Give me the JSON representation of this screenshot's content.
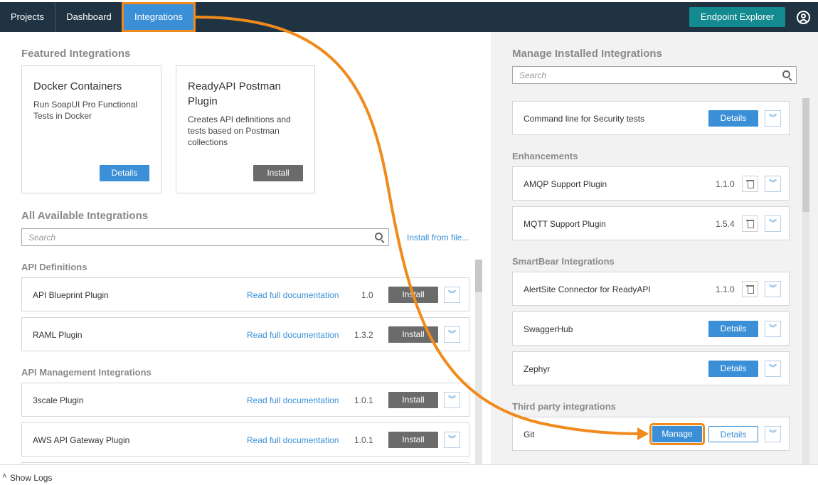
{
  "nav": {
    "tabs": [
      "Projects",
      "Dashboard",
      "Integrations"
    ],
    "endpoint_explorer": "Endpoint Explorer"
  },
  "featured": {
    "title": "Featured Integrations",
    "cards": [
      {
        "title": "Docker Containers",
        "desc": "Run SoapUI Pro Functional Tests in Docker",
        "button": "Details"
      },
      {
        "title": "ReadyAPI Postman Plugin",
        "desc": "Creates API definitions and tests based on Postman collections",
        "button": "Install"
      }
    ]
  },
  "available": {
    "title": "All Available Integrations",
    "search_placeholder": "Search",
    "install_from_file": "Install from file...",
    "groups": [
      {
        "title": "API Definitions",
        "items": [
          {
            "name": "API Blueprint Plugin",
            "doc": "Read full documentation",
            "version": "1.0",
            "button": "Install"
          },
          {
            "name": "RAML Plugin",
            "doc": "Read full documentation",
            "version": "1.3.2",
            "button": "Install"
          }
        ]
      },
      {
        "title": "API Management Integrations",
        "items": [
          {
            "name": "3scale Plugin",
            "doc": "Read full documentation",
            "version": "1.0.1",
            "button": "Install"
          },
          {
            "name": "AWS API Gateway Plugin",
            "doc": "Read full documentation",
            "version": "1.0.1",
            "button": "Install"
          }
        ]
      }
    ]
  },
  "installed": {
    "title": "Manage Installed Integrations",
    "search_placeholder": "Search",
    "top_item": {
      "name": "Command line for Security tests",
      "button": "Details"
    },
    "groups": [
      {
        "title": "Enhancements",
        "items": [
          {
            "name": "AMQP Support Plugin",
            "version": "1.1.0"
          },
          {
            "name": "MQTT Support Plugin",
            "version": "1.5.4"
          }
        ]
      },
      {
        "title": "SmartBear Integrations",
        "items": [
          {
            "name": "AlertSite Connector for ReadyAPI",
            "version": "1.1.0"
          },
          {
            "name": "SwaggerHub",
            "button": "Details"
          },
          {
            "name": "Zephyr",
            "button": "Details"
          }
        ]
      },
      {
        "title": "Third party integrations",
        "items": [
          {
            "name": "Git",
            "manage": "Manage",
            "button": "Details"
          }
        ]
      }
    ]
  },
  "footer": {
    "show_logs": "Show Logs"
  },
  "colors": {
    "accent": "#3a8fd6",
    "topbar": "#1f3342",
    "highlight": "#f08a1c",
    "teal": "#138a8f"
  }
}
